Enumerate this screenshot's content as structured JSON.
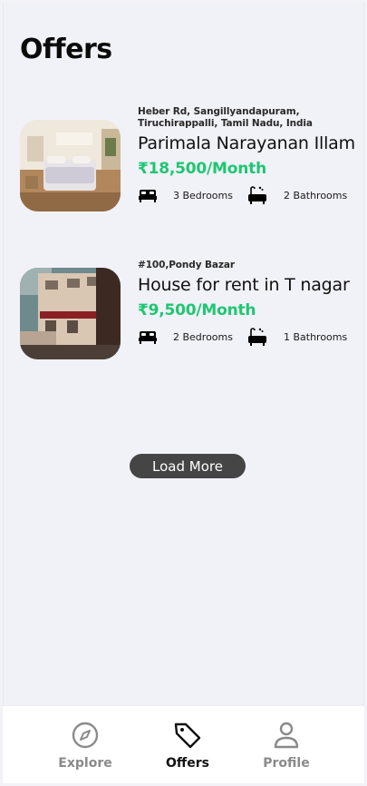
{
  "page": {
    "title": "Offers"
  },
  "listings": [
    {
      "address": "Heber Rd, Sangillyandapuram, Tiruchirappalli, Tamil Nadu, India",
      "name": "Parimala Narayanan Illam",
      "price": "₹18,500/Month",
      "bedrooms": "3 Bedrooms",
      "bathrooms": "2 Bathrooms"
    },
    {
      "address": "#100,Pondy Bazar",
      "name": "House for rent in T nagar",
      "price": "₹9,500/Month",
      "bedrooms": "2 Bedrooms",
      "bathrooms": "1 Bathrooms"
    }
  ],
  "load_more": "Load More",
  "nav": {
    "explore": "Explore",
    "offers": "Offers",
    "profile": "Profile",
    "active": "offers"
  },
  "colors": {
    "price": "#1ec771",
    "button_bg": "#454545",
    "nav_inactive": "#8a8a8a"
  },
  "icons": {
    "bed": "bed-icon",
    "bath": "bathtub-icon",
    "explore": "compass-icon",
    "offers": "tag-icon",
    "profile": "user-icon"
  }
}
